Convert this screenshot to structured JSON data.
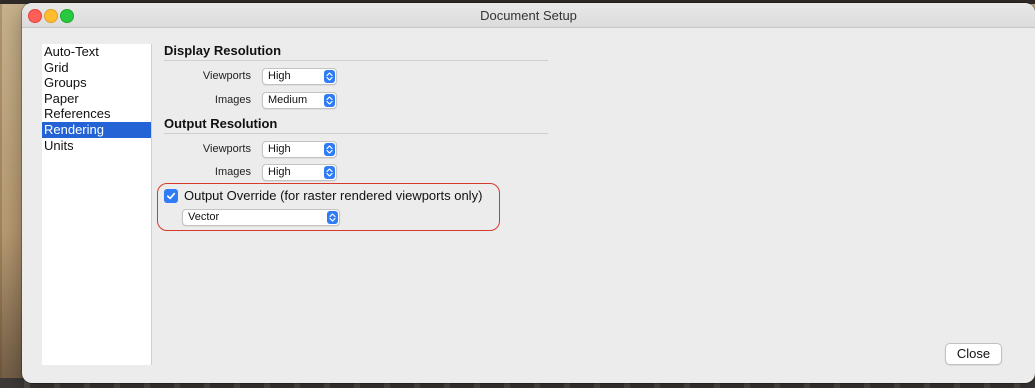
{
  "window": {
    "title": "Document Setup"
  },
  "sidebar": {
    "items": [
      {
        "label": "Auto-Text",
        "selected": false
      },
      {
        "label": "Grid",
        "selected": false
      },
      {
        "label": "Groups",
        "selected": false
      },
      {
        "label": "Paper",
        "selected": false
      },
      {
        "label": "References",
        "selected": false
      },
      {
        "label": "Rendering",
        "selected": true
      },
      {
        "label": "Units",
        "selected": false
      }
    ]
  },
  "display_resolution": {
    "title": "Display Resolution",
    "viewports": {
      "label": "Viewports",
      "value": "High"
    },
    "images": {
      "label": "Images",
      "value": "Medium"
    }
  },
  "output_resolution": {
    "title": "Output Resolution",
    "viewports": {
      "label": "Viewports",
      "value": "High"
    },
    "images": {
      "label": "Images",
      "value": "High"
    }
  },
  "output_override": {
    "label": "Output Override (for raster rendered viewports only)",
    "checked": true,
    "value": "Vector"
  },
  "footer": {
    "close_label": "Close"
  },
  "colors": {
    "accent": "#2f7cf6",
    "selection": "#2463d5",
    "highlight_ring": "#d53a2c"
  }
}
